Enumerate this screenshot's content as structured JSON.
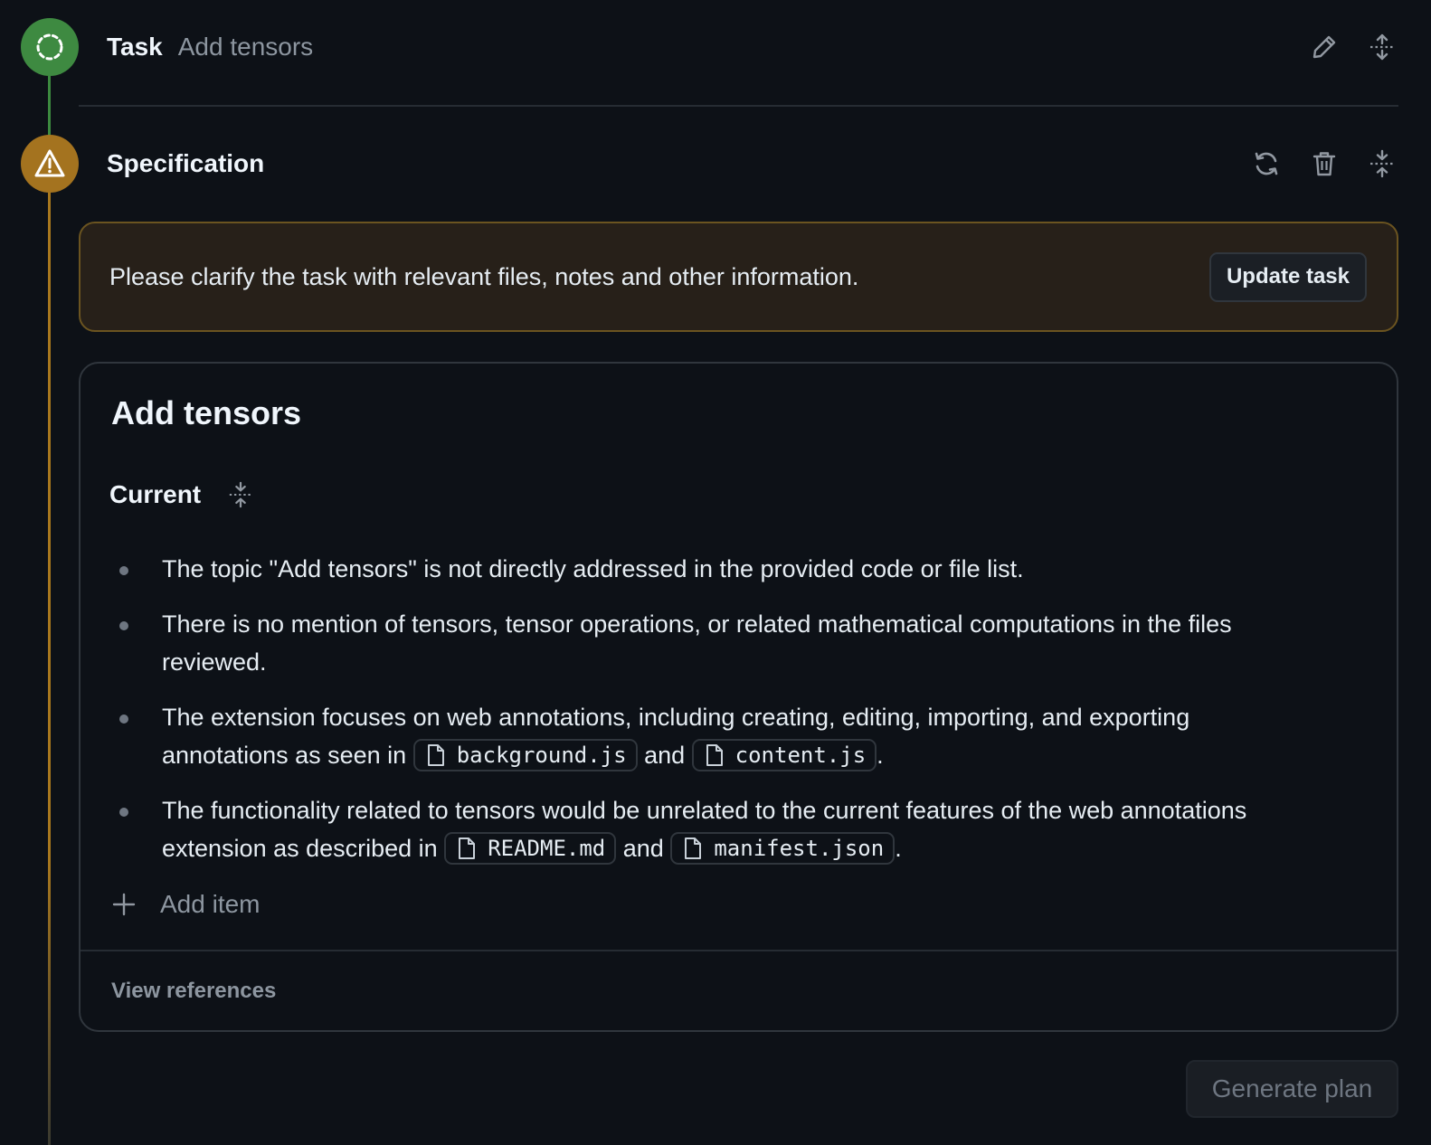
{
  "task": {
    "title": "Task",
    "subtitle": "Add tensors"
  },
  "specification": {
    "title": "Specification",
    "warning": {
      "text": "Please clarify the task with relevant files, notes and other information.",
      "button_label": "Update task"
    },
    "card": {
      "title": "Add tensors",
      "section_title": "Current",
      "bullets": [
        {
          "text_before": "The topic \"Add tensors\" is not directly addressed in the provided code or file list."
        },
        {
          "text_before": "There is no mention of tensors, tensor operations, or related mathematical computations in the files reviewed."
        },
        {
          "text_before": "The extension focuses on web annotations, including creating, editing, importing, and exporting annotations as seen in",
          "file_1": "background.js",
          "joiner": "and",
          "file_2": "content.js",
          "text_after": "."
        },
        {
          "text_before": "The functionality related to tensors would be unrelated to the current features of the web annotations extension as described in",
          "file_1": "README.md",
          "joiner": "and",
          "file_2": "manifest.json",
          "text_after": "."
        }
      ],
      "add_item_label": "Add item",
      "view_references_label": "View references"
    }
  },
  "footer": {
    "generate_plan_label": "Generate plan"
  },
  "colors": {
    "background": "#0d1117",
    "task_node": "#3e8a41",
    "spec_node": "#a4731f",
    "warning_bg": "#272019",
    "warning_border": "#6b5420"
  },
  "icons": {
    "task_node": "dashed-circle-icon",
    "spec_node": "alert-triangle-icon",
    "edit": "pencil-icon",
    "expand": "unfold-icon",
    "regenerate": "sync-icon",
    "delete": "trash-icon",
    "collapse": "fold-icon",
    "file": "file-icon",
    "add": "plus-icon"
  }
}
